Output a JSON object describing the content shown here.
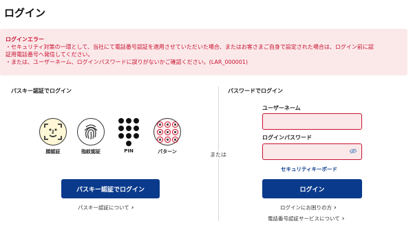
{
  "page": {
    "title": "ログイン"
  },
  "error": {
    "title": "ログインエラー",
    "line1": "・セキュリティ対策の一環として、当社にて電話番号認証を適用させていただいた場合、またはお客さまご自身で設定された場合は、ログイン前に認",
    "line2": "証用電話番号へ発信してください。",
    "line3": "・または、ユーザーネーム、ログインパスワードに誤りがないかご確認ください。(LAR_000001)",
    "color": "#c8102e",
    "background": "#fbe9ea"
  },
  "passkey": {
    "section_title": "パスキー認証でログイン",
    "methods": [
      {
        "label": "顔認証",
        "icon": "face-icon"
      },
      {
        "label": "指紋認証",
        "icon": "fingerprint-icon"
      },
      {
        "label": "PIN",
        "icon": "pin-dots-icon"
      },
      {
        "label": "パターン",
        "icon": "pattern-icon"
      }
    ],
    "button_label": "パスキー認証でログイン",
    "about_link": "パスキー認証について"
  },
  "divider": {
    "or_text": "または"
  },
  "password": {
    "section_title": "パスワードでログイン",
    "username_label": "ユーザーネーム",
    "username_value": "",
    "password_label": "ログインパスワード",
    "password_value": "",
    "keyboard_link": "セキュリティキーボード",
    "login_button": "ログイン",
    "trouble_link": "ログインにお困りの方",
    "phone_auth_link": "電話番号認証サービスについて"
  },
  "colors": {
    "primary": "#0a3a8c",
    "error": "#c8102e"
  }
}
